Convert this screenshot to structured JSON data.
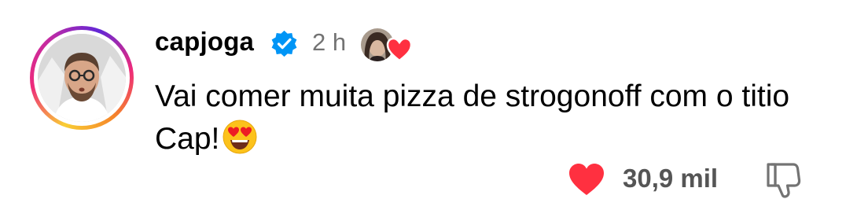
{
  "comment": {
    "username": "capjoga",
    "time": "2 h",
    "text": "Vai comer muita pizza de strogonoff com o titio Cap!",
    "emoji": "heart-eyes-emoji",
    "likes": "30,9 mil"
  },
  "icons": {
    "verified": "verified-badge-icon",
    "like": "heart-icon",
    "report": "thumbs-down-icon"
  },
  "colors": {
    "verified": "#0095f6",
    "heart": "#ff3040",
    "secondary_text": "#737373"
  }
}
